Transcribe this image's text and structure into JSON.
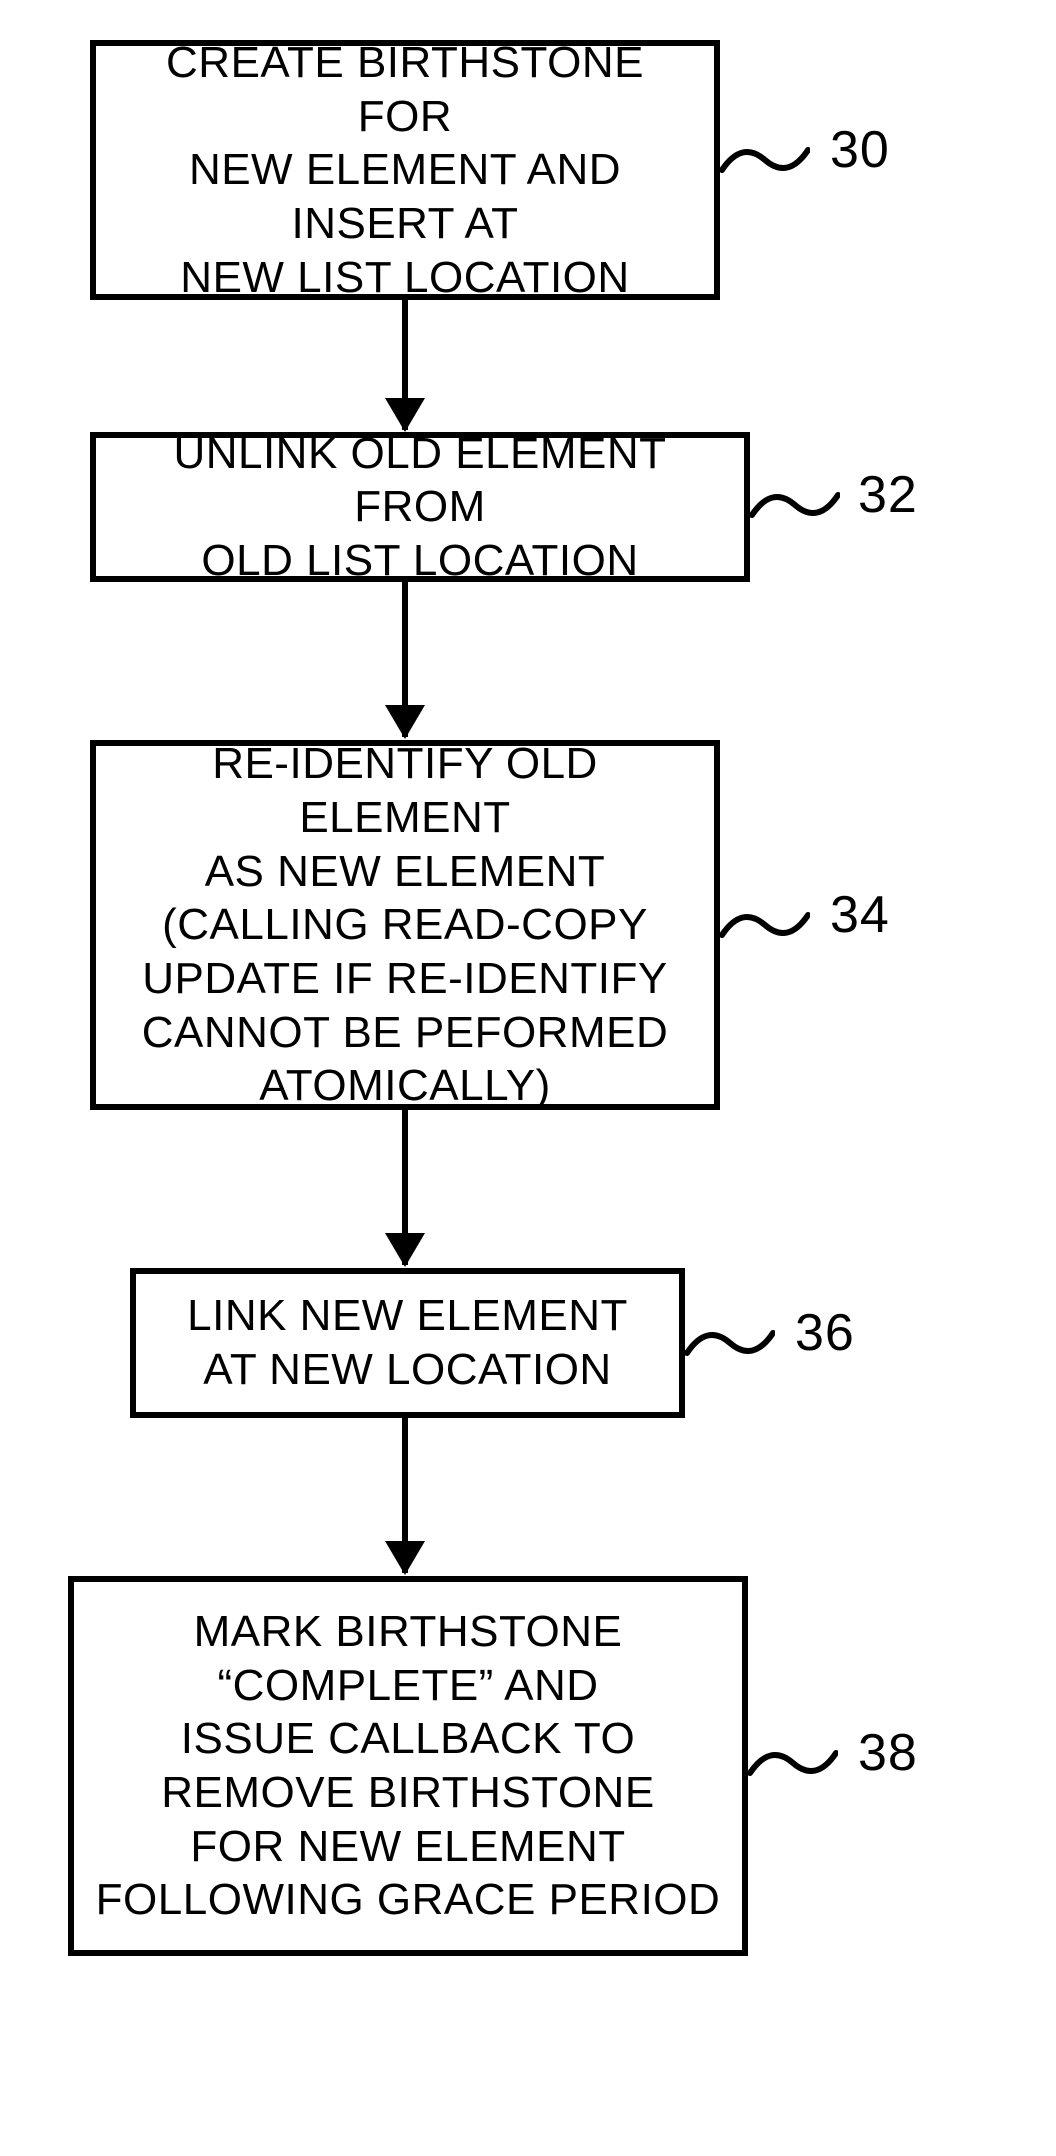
{
  "boxes": {
    "b30": {
      "text": "CREATE BIRTHSTONE FOR\nNEW ELEMENT AND\nINSERT AT\nNEW LIST LOCATION",
      "label": "30"
    },
    "b32": {
      "text": "UNLINK OLD ELEMENT FROM\nOLD LIST LOCATION",
      "label": "32"
    },
    "b34": {
      "text": "RE-IDENTIFY OLD ELEMENT\nAS NEW ELEMENT\n(CALLING READ-COPY\nUPDATE IF RE-IDENTIFY\nCANNOT BE PEFORMED\nATOMICALLY)",
      "label": "34"
    },
    "b36": {
      "text": "LINK NEW ELEMENT\nAT NEW LOCATION",
      "label": "36"
    },
    "b38": {
      "text": "MARK BIRTHSTONE\n“COMPLETE” AND\nISSUE CALLBACK TO\nREMOVE BIRTHSTONE\nFOR NEW ELEMENT\nFOLLOWING GRACE PERIOD",
      "label": "38"
    }
  }
}
